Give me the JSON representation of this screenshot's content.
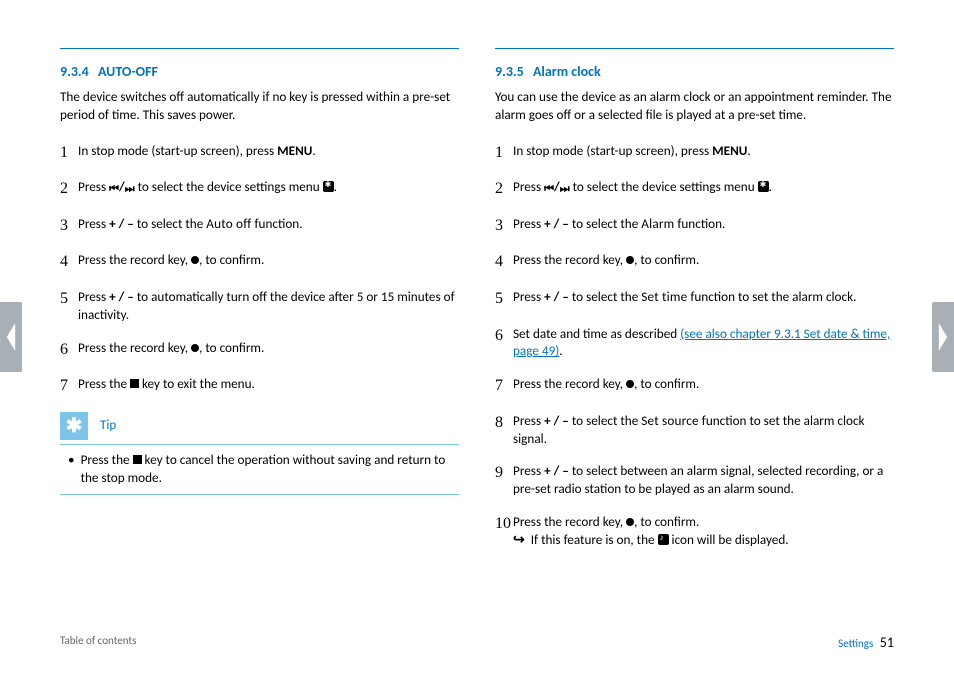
{
  "left": {
    "heading_num": "9.3.4",
    "heading_title": "AUTO-OFF",
    "intro": "The device switches off automatically if no key is pressed within a pre-set period of time. This saves power.",
    "steps": {
      "s1a": "In stop mode (start-up screen), press ",
      "s1b": "MENU",
      "s1c": ".",
      "s2a": "Press ",
      "s2b": " to select the device settings menu ",
      "s2c": ".",
      "s3a": "Press ",
      "s3b": "+ / –",
      "s3c": " to select the ",
      "s3d": "Auto off",
      "s3e": " function.",
      "s4a": "Press the record key, ",
      "s4b": ", to confirm.",
      "s5a": "Press ",
      "s5b": "+ / –",
      "s5c": " to automatically turn off the device after 5 or 15 minutes of inactivity.",
      "s6a": "Press the record key, ",
      "s6b": ", to confirm.",
      "s7a": "Press the ",
      "s7b": " key to exit the menu."
    },
    "tip_label": "Tip",
    "tip_a": "Press the ",
    "tip_b": " key to cancel the operation without saving and return to the stop mode."
  },
  "right": {
    "heading_num": "9.3.5",
    "heading_title": "Alarm clock",
    "intro": "You can use the device as an alarm clock or an appointment reminder. The alarm goes off or a selected file is played at a pre-set time.",
    "steps": {
      "s1a": "In stop mode (start-up screen), press ",
      "s1b": "MENU",
      "s1c": ".",
      "s2a": "Press ",
      "s2b": " to select the device settings menu ",
      "s2c": ".",
      "s3a": "Press ",
      "s3b": "+ / –",
      "s3c": " to select the ",
      "s3d": "Alarm",
      "s3e": " function.",
      "s4a": "Press the record key, ",
      "s4b": ", to confirm.",
      "s5a": "Press ",
      "s5b": "+ / –",
      "s5c": " to select the ",
      "s5d": "Set time",
      "s5e": " function to set the alarm clock.",
      "s6a": "Set date and time as described ",
      "s6link": "(see also chapter 9.3.1 Set date & time, page 49)",
      "s6b": ".",
      "s7a": "Press the record key, ",
      "s7b": ", to confirm.",
      "s8a": "Press ",
      "s8b": "+ / –",
      "s8c": " to select the ",
      "s8d": "Set source",
      "s8e": "  function to set the alarm clock signal.",
      "s9a": "Press ",
      "s9b": "+ / –",
      "s9c": " to select between an alarm signal, selected recording, or a pre-set radio station to be played as an alarm sound.",
      "s10a": "Press the record key, ",
      "s10b": ", to confirm.",
      "s10res_a": "If this feature is on, the ",
      "s10res_b": " icon will be displayed."
    }
  },
  "footer": {
    "toc": "Table of contents",
    "section": "Settings",
    "page": "51"
  }
}
